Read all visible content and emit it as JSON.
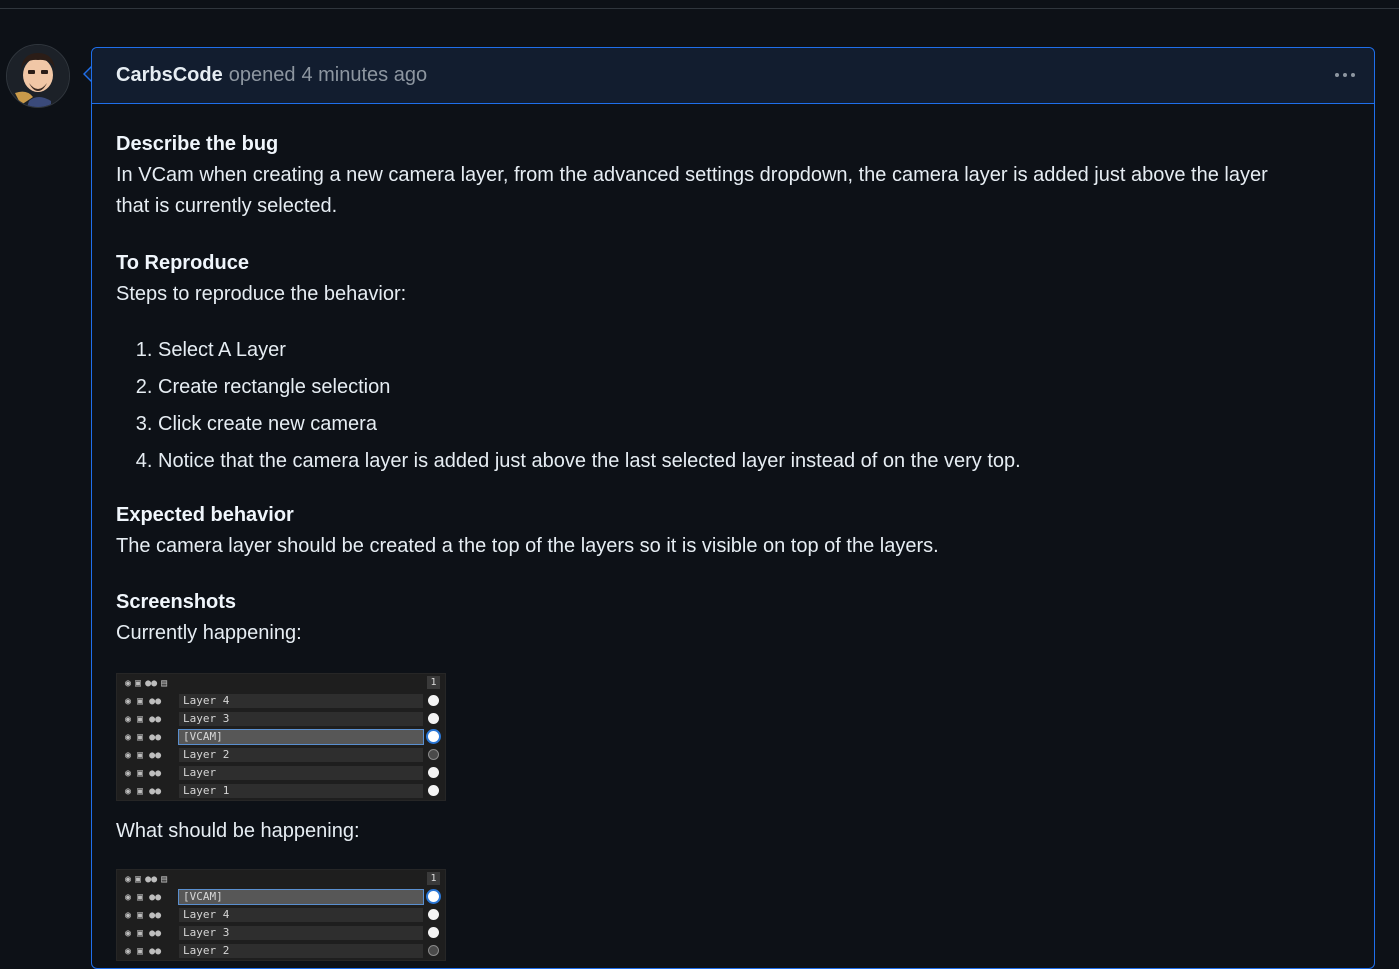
{
  "comment": {
    "author": "CarbsCode",
    "action": "opened",
    "time": "4 minutes ago",
    "menu_icon": "kebab-horizontal-icon"
  },
  "body": {
    "bug_heading": "Describe the bug",
    "bug_text_1": "In VCam when creating a new camera layer, from the advanced settings dropdown, the camera layer is added just above the layer",
    "bug_text_2": "that is currently selected.",
    "repro_heading": "To Reproduce",
    "repro_text": "Steps to reproduce the behavior:",
    "steps": [
      "Select A Layer",
      "Create rectangle selection",
      "Click create new camera",
      "Notice that the camera layer is added just above the last selected layer instead of on the very top."
    ],
    "expected_heading": "Expected behavior",
    "expected_text": "The camera layer should be created a the top of the layers so it is visible on top of the layers.",
    "screenshots_heading": "Screenshots",
    "current_label": "Currently happening:",
    "should_label": "What should be happening:"
  },
  "screenshot_current": {
    "header_number": "1",
    "rows": [
      {
        "label": "Layer 4",
        "selected": false,
        "hollow": false
      },
      {
        "label": "Layer 3",
        "selected": false,
        "hollow": false
      },
      {
        "label": "[VCAM]",
        "selected": true,
        "hollow": false
      },
      {
        "label": "Layer 2",
        "selected": false,
        "hollow": true
      },
      {
        "label": "Layer",
        "selected": false,
        "hollow": false
      },
      {
        "label": "Layer 1",
        "selected": false,
        "hollow": false
      }
    ]
  },
  "screenshot_expected": {
    "header_number": "1",
    "rows": [
      {
        "label": "[VCAM]",
        "selected": true,
        "hollow": false
      },
      {
        "label": "Layer 4",
        "selected": false,
        "hollow": false
      },
      {
        "label": "Layer 3",
        "selected": false,
        "hollow": false
      },
      {
        "label": "Layer 2",
        "selected": false,
        "hollow": true
      }
    ]
  }
}
